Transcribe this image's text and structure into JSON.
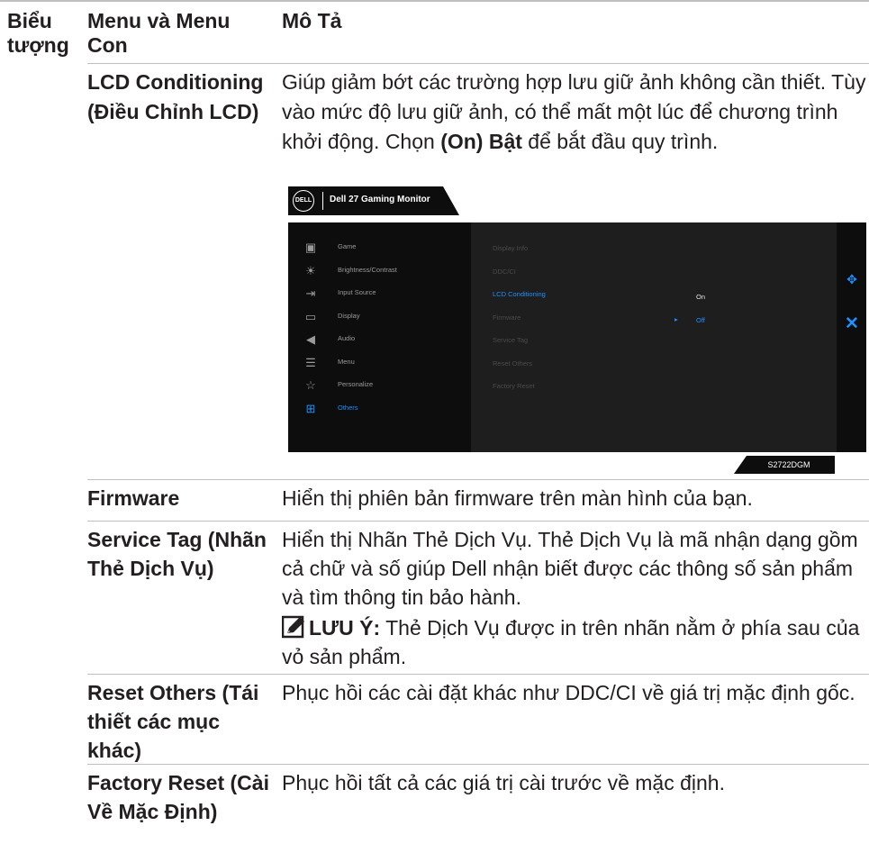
{
  "header": {
    "col_icon": "Biểu tượng",
    "col_menu": "Menu và Menu Con",
    "col_desc": "Mô Tả"
  },
  "lcd": {
    "name": "LCD Conditioning (Điều Chỉnh LCD)",
    "desc_pre": "Giúp giảm bớt các trường hợp lưu giữ ảnh không cần thiết. Tùy vào mức độ lưu giữ ảnh, có thể mất một lúc để chương trình khởi động. Chọn ",
    "desc_bold": "(On) Bật",
    "desc_post": " để bắt đầu quy trình."
  },
  "osd": {
    "logo": "DELL",
    "title": "Dell 27 Gaming Monitor",
    "menu": [
      {
        "label": "Game",
        "icon": "game-icon",
        "glyph": "▣"
      },
      {
        "label": "Brightness/Contrast",
        "icon": "brightness-icon",
        "glyph": "☀"
      },
      {
        "label": "Input Source",
        "icon": "input-source-icon",
        "glyph": "⇥"
      },
      {
        "label": "Display",
        "icon": "display-icon",
        "glyph": "▭"
      },
      {
        "label": "Audio",
        "icon": "audio-icon",
        "glyph": "◀"
      },
      {
        "label": "Menu",
        "icon": "menu-icon",
        "glyph": "☰"
      },
      {
        "label": "Personalize",
        "icon": "star-icon",
        "glyph": "☆"
      },
      {
        "label": "Others",
        "icon": "others-icon",
        "glyph": "⊞"
      }
    ],
    "submenu": [
      {
        "label": "Display Info"
      },
      {
        "label": "DDC/CI"
      },
      {
        "label": "LCD Conditioning"
      },
      {
        "label": "Firmware"
      },
      {
        "label": "Service Tag"
      },
      {
        "label": "Reset Others"
      },
      {
        "label": "Factory Reset"
      }
    ],
    "option_on": "On",
    "option_off": "Off",
    "model": "S2722DGM",
    "accent_color": "#1e90ff"
  },
  "firmware": {
    "name": "Firmware",
    "desc": "Hiển thị phiên bản firmware trên màn hình của bạn."
  },
  "service_tag": {
    "name": "Service Tag (Nhãn Thẻ Dịch Vụ)",
    "desc": "Hiển thị Nhãn Thẻ Dịch Vụ. Thẻ Dịch Vụ là mã nhận dạng gồm cả chữ và số giúp Dell nhận biết được các thông số sản phẩm và tìm thông tin bảo hành.",
    "note_label": "LƯU Ý:",
    "note_text": " Thẻ Dịch Vụ được in trên nhãn nằm ở phía sau của vỏ sản phẩm."
  },
  "reset_others": {
    "name": "Reset Others (Tái thiết các mục khác)",
    "desc": "Phục hồi các cài đặt khác như DDC/CI về giá trị mặc định gốc."
  },
  "factory_reset": {
    "name": "Factory Reset (Cài Về Mặc Định)",
    "desc": "Phục hồi tất cả các giá trị cài trước về mặc định."
  }
}
